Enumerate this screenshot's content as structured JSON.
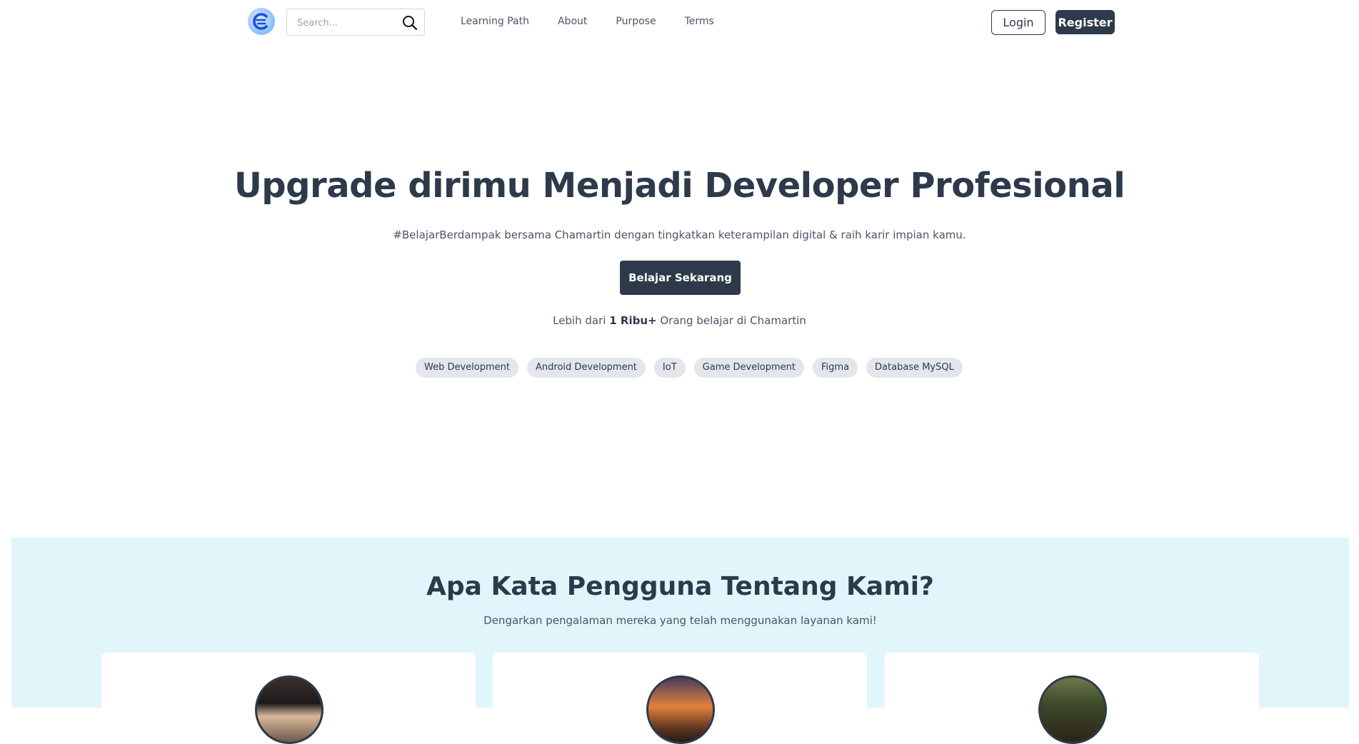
{
  "navbar": {
    "search_placeholder": "Search...",
    "links": [
      "Learning Path",
      "About",
      "Purpose",
      "Terms"
    ],
    "login_label": "Login",
    "register_label": "Register"
  },
  "hero": {
    "title": "Upgrade dirimu Menjadi Developer Profesional",
    "subtitle": "#BelajarBerdampak bersama Chamartin dengan tingkatkan keterampilan digital & raih karir impian kamu.",
    "cta_label": "Belajar Sekarang",
    "stat_prefix": "Lebih dari",
    "stat_value": "1 Ribu+",
    "stat_suffix": "Orang belajar di Chamartin",
    "tags": [
      "Web Development",
      "Android Development",
      "IoT",
      "Game Development",
      "Figma",
      "Database MySQL"
    ]
  },
  "testimonials": {
    "title": "Apa Kata Pengguna Tentang Kami?",
    "subtitle": "Dengarkan pengalaman mereka yang telah menggunakan layanan kami!"
  },
  "colors": {
    "primary": "#2d3a4b",
    "testimonial_bg": "#e0f6fa",
    "tag_bg": "#e3e6ea"
  }
}
